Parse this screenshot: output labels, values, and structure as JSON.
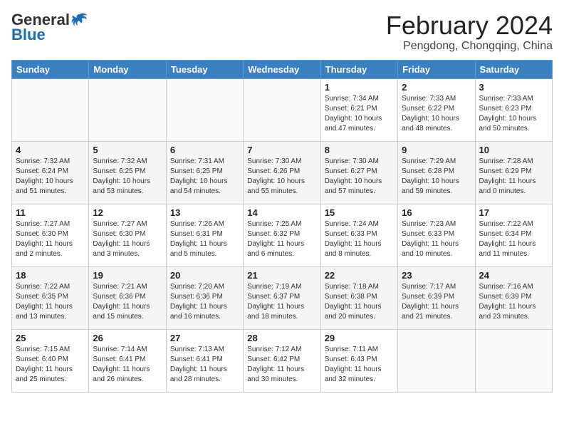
{
  "logo": {
    "general": "General",
    "blue": "Blue"
  },
  "title": "February 2024",
  "subtitle": "Pengdong, Chongqing, China",
  "headers": [
    "Sunday",
    "Monday",
    "Tuesday",
    "Wednesday",
    "Thursday",
    "Friday",
    "Saturday"
  ],
  "weeks": [
    [
      {
        "day": "",
        "info": ""
      },
      {
        "day": "",
        "info": ""
      },
      {
        "day": "",
        "info": ""
      },
      {
        "day": "",
        "info": ""
      },
      {
        "day": "1",
        "info": "Sunrise: 7:34 AM\nSunset: 6:21 PM\nDaylight: 10 hours and 47 minutes."
      },
      {
        "day": "2",
        "info": "Sunrise: 7:33 AM\nSunset: 6:22 PM\nDaylight: 10 hours and 48 minutes."
      },
      {
        "day": "3",
        "info": "Sunrise: 7:33 AM\nSunset: 6:23 PM\nDaylight: 10 hours and 50 minutes."
      }
    ],
    [
      {
        "day": "4",
        "info": "Sunrise: 7:32 AM\nSunset: 6:24 PM\nDaylight: 10 hours and 51 minutes."
      },
      {
        "day": "5",
        "info": "Sunrise: 7:32 AM\nSunset: 6:25 PM\nDaylight: 10 hours and 53 minutes."
      },
      {
        "day": "6",
        "info": "Sunrise: 7:31 AM\nSunset: 6:25 PM\nDaylight: 10 hours and 54 minutes."
      },
      {
        "day": "7",
        "info": "Sunrise: 7:30 AM\nSunset: 6:26 PM\nDaylight: 10 hours and 55 minutes."
      },
      {
        "day": "8",
        "info": "Sunrise: 7:30 AM\nSunset: 6:27 PM\nDaylight: 10 hours and 57 minutes."
      },
      {
        "day": "9",
        "info": "Sunrise: 7:29 AM\nSunset: 6:28 PM\nDaylight: 10 hours and 59 minutes."
      },
      {
        "day": "10",
        "info": "Sunrise: 7:28 AM\nSunset: 6:29 PM\nDaylight: 11 hours and 0 minutes."
      }
    ],
    [
      {
        "day": "11",
        "info": "Sunrise: 7:27 AM\nSunset: 6:30 PM\nDaylight: 11 hours and 2 minutes."
      },
      {
        "day": "12",
        "info": "Sunrise: 7:27 AM\nSunset: 6:30 PM\nDaylight: 11 hours and 3 minutes."
      },
      {
        "day": "13",
        "info": "Sunrise: 7:26 AM\nSunset: 6:31 PM\nDaylight: 11 hours and 5 minutes."
      },
      {
        "day": "14",
        "info": "Sunrise: 7:25 AM\nSunset: 6:32 PM\nDaylight: 11 hours and 6 minutes."
      },
      {
        "day": "15",
        "info": "Sunrise: 7:24 AM\nSunset: 6:33 PM\nDaylight: 11 hours and 8 minutes."
      },
      {
        "day": "16",
        "info": "Sunrise: 7:23 AM\nSunset: 6:33 PM\nDaylight: 11 hours and 10 minutes."
      },
      {
        "day": "17",
        "info": "Sunrise: 7:22 AM\nSunset: 6:34 PM\nDaylight: 11 hours and 11 minutes."
      }
    ],
    [
      {
        "day": "18",
        "info": "Sunrise: 7:22 AM\nSunset: 6:35 PM\nDaylight: 11 hours and 13 minutes."
      },
      {
        "day": "19",
        "info": "Sunrise: 7:21 AM\nSunset: 6:36 PM\nDaylight: 11 hours and 15 minutes."
      },
      {
        "day": "20",
        "info": "Sunrise: 7:20 AM\nSunset: 6:36 PM\nDaylight: 11 hours and 16 minutes."
      },
      {
        "day": "21",
        "info": "Sunrise: 7:19 AM\nSunset: 6:37 PM\nDaylight: 11 hours and 18 minutes."
      },
      {
        "day": "22",
        "info": "Sunrise: 7:18 AM\nSunset: 6:38 PM\nDaylight: 11 hours and 20 minutes."
      },
      {
        "day": "23",
        "info": "Sunrise: 7:17 AM\nSunset: 6:39 PM\nDaylight: 11 hours and 21 minutes."
      },
      {
        "day": "24",
        "info": "Sunrise: 7:16 AM\nSunset: 6:39 PM\nDaylight: 11 hours and 23 minutes."
      }
    ],
    [
      {
        "day": "25",
        "info": "Sunrise: 7:15 AM\nSunset: 6:40 PM\nDaylight: 11 hours and 25 minutes."
      },
      {
        "day": "26",
        "info": "Sunrise: 7:14 AM\nSunset: 6:41 PM\nDaylight: 11 hours and 26 minutes."
      },
      {
        "day": "27",
        "info": "Sunrise: 7:13 AM\nSunset: 6:41 PM\nDaylight: 11 hours and 28 minutes."
      },
      {
        "day": "28",
        "info": "Sunrise: 7:12 AM\nSunset: 6:42 PM\nDaylight: 11 hours and 30 minutes."
      },
      {
        "day": "29",
        "info": "Sunrise: 7:11 AM\nSunset: 6:43 PM\nDaylight: 11 hours and 32 minutes."
      },
      {
        "day": "",
        "info": ""
      },
      {
        "day": "",
        "info": ""
      }
    ]
  ]
}
